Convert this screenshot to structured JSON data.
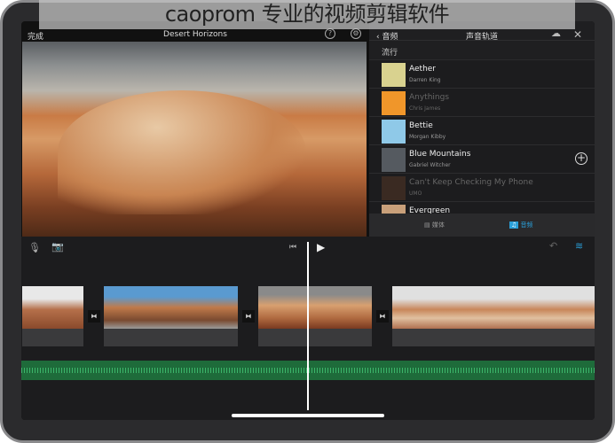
{
  "watermark": "caoprom 专业的视频剪辑软件",
  "header": {
    "done": "完成",
    "project_title": "Desert Horizons",
    "help_icon": "?",
    "settings_icon": "gear-icon"
  },
  "panel": {
    "back_label": "音频",
    "title": "声音轨道",
    "section": "流行",
    "tracks": [
      {
        "name": "Aether",
        "artist": "Darren King",
        "color": "#d9d28f",
        "dim": false
      },
      {
        "name": "Anythings",
        "artist": "Chris James",
        "color": "#f0962a",
        "dim": true
      },
      {
        "name": "Bettie",
        "artist": "Morgan Kibby",
        "color": "#8fc9e8",
        "dim": false
      },
      {
        "name": "Blue Mountains",
        "artist": "Gabriel Witcher",
        "color": "#555a60",
        "dim": false
      },
      {
        "name": "Can't Keep Checking My Phone",
        "artist": "UMO",
        "color": "#3a2a22",
        "dim": true
      },
      {
        "name": "Evergreen",
        "artist": "",
        "color": "#c9a07a",
        "dim": false
      }
    ],
    "tabs": {
      "media": "媒体",
      "audio": "音频"
    },
    "accent": "#2a9fd8"
  }
}
